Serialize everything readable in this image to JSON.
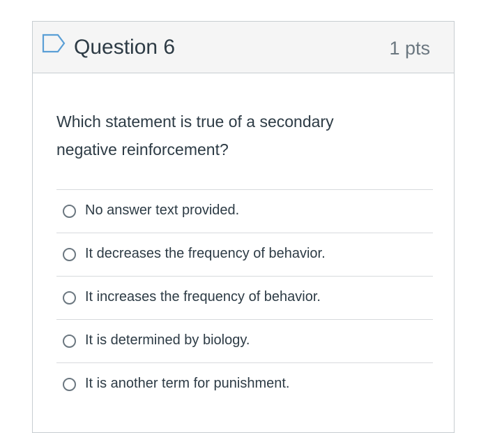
{
  "question": {
    "title": "Question 6",
    "points": "1 pts",
    "text": "Which statement is true of a secondary negative reinforcement?",
    "flag_icon": "bookmark-flag-icon",
    "accent_color": "#5a9fd6"
  },
  "answers": [
    {
      "label": "No answer text provided.",
      "selected": false
    },
    {
      "label": "It decreases the frequency of behavior.",
      "selected": false
    },
    {
      "label": "It increases the frequency of behavior.",
      "selected": false
    },
    {
      "label": "It is determined by biology.",
      "selected": false
    },
    {
      "label": "It is another term for punishment.",
      "selected": false
    }
  ]
}
